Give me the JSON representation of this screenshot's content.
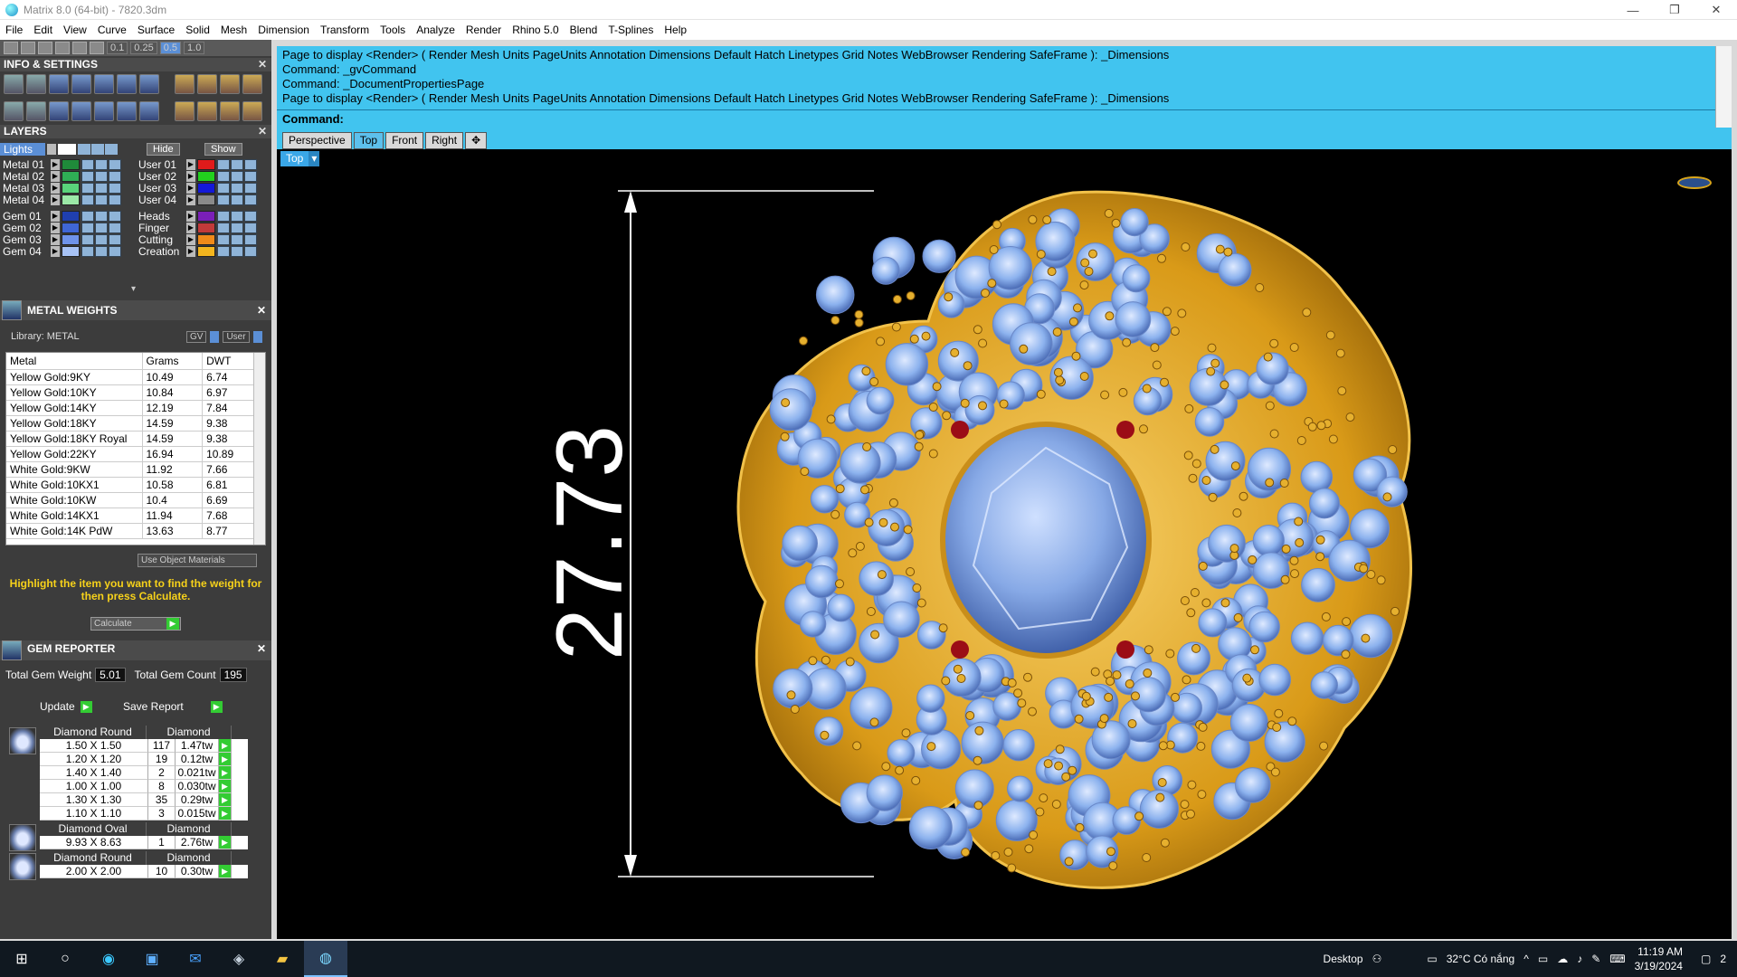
{
  "window": {
    "title": "Matrix 8.0 (64-bit) - 7820.3dm"
  },
  "menu": [
    "File",
    "Edit",
    "View",
    "Curve",
    "Surface",
    "Solid",
    "Mesh",
    "Dimension",
    "Transform",
    "Tools",
    "Analyze",
    "Render",
    "Rhino 5.0",
    "Blend",
    "T-Splines",
    "Help"
  ],
  "toolstrip": {
    "values": [
      "0.1",
      "0.25",
      "0.5",
      "1.0"
    ]
  },
  "info_settings": {
    "title": "INFO & SETTINGS"
  },
  "layers": {
    "title": "LAYERS",
    "lights_label": "Lights",
    "hide_label": "Hide",
    "show_label": "Show",
    "left": [
      {
        "name": "Metal 01",
        "color": "#1f8a3a"
      },
      {
        "name": "Metal 02",
        "color": "#2fae55"
      },
      {
        "name": "Metal 03",
        "color": "#59d37a"
      },
      {
        "name": "Metal 04",
        "color": "#9be8a7"
      },
      {
        "name": "Gem 01",
        "color": "#1f3fb0"
      },
      {
        "name": "Gem 02",
        "color": "#3f66d6"
      },
      {
        "name": "Gem 03",
        "color": "#6f93ea"
      },
      {
        "name": "Gem 04",
        "color": "#a7c2f5"
      }
    ],
    "right": [
      {
        "name": "User 01",
        "color": "#e01b1b"
      },
      {
        "name": "User 02",
        "color": "#22d11e"
      },
      {
        "name": "User 03",
        "color": "#1419d8"
      },
      {
        "name": "User 04",
        "color": "#8a8a8a"
      },
      {
        "name": "Heads",
        "color": "#7a1fb8"
      },
      {
        "name": "Finger",
        "color": "#c23a3a"
      },
      {
        "name": "Cutting",
        "color": "#f08a19"
      },
      {
        "name": "Creation",
        "color": "#f3b51e"
      }
    ]
  },
  "metal_weights": {
    "title": "METAL WEIGHTS",
    "library_label": "Library: METAL",
    "gv_label": "GV",
    "user_label": "User",
    "columns": [
      "Metal",
      "Grams",
      "DWT"
    ],
    "rows": [
      [
        "Yellow Gold:9KY",
        "10.49",
        "6.74"
      ],
      [
        "Yellow Gold:10KY",
        "10.84",
        "6.97"
      ],
      [
        "Yellow Gold:14KY",
        "12.19",
        "7.84"
      ],
      [
        "Yellow Gold:18KY",
        "14.59",
        "9.38"
      ],
      [
        "Yellow Gold:18KY Royal",
        "14.59",
        "9.38"
      ],
      [
        "Yellow Gold:22KY",
        "16.94",
        "10.89"
      ],
      [
        "White Gold:9KW",
        "11.92",
        "7.66"
      ],
      [
        "White Gold:10KX1",
        "10.58",
        "6.81"
      ],
      [
        "White Gold:10KW",
        "10.4",
        "6.69"
      ],
      [
        "White Gold:14KX1",
        "11.94",
        "7.68"
      ],
      [
        "White Gold:14K PdW",
        "13.63",
        "8.77"
      ]
    ],
    "use_object_materials": "Use Object Materials",
    "hint": "Highlight the item you want to find the weight for then press Calculate.",
    "calculate_label": "Calculate"
  },
  "gem_reporter": {
    "title": "GEM REPORTER",
    "total_weight_label": "Total Gem Weight",
    "total_weight": "5.01",
    "total_count_label": "Total Gem Count",
    "total_count": "195",
    "update_label": "Update",
    "save_label": "Save Report",
    "groups": [
      {
        "cut": "Diamond Round",
        "material": "Diamond",
        "rows": [
          [
            "1.50 X 1.50",
            "117",
            "1.47tw"
          ],
          [
            "1.20 X 1.20",
            "19",
            "0.12tw"
          ],
          [
            "1.40 X 1.40",
            "2",
            "0.021tw"
          ],
          [
            "1.00 X 1.00",
            "8",
            "0.030tw"
          ],
          [
            "1.30 X 1.30",
            "35",
            "0.29tw"
          ],
          [
            "1.10 X 1.10",
            "3",
            "0.015tw"
          ]
        ]
      },
      {
        "cut": "Diamond Oval",
        "material": "Diamond",
        "rows": [
          [
            "9.93 X 8.63",
            "1",
            "2.76tw"
          ]
        ]
      },
      {
        "cut": "Diamond Round",
        "material": "Diamond",
        "rows": [
          [
            "2.00 X 2.00",
            "10",
            "0.30tw"
          ]
        ]
      }
    ]
  },
  "command": {
    "history": [
      "Page to display <Render> ( Render  Mesh  Units  PageUnits  Annotation  Dimensions  Default  Hatch  Linetypes  Grid  Notes  WebBrowser  Rendering  SafeFrame ): _Dimensions",
      "Command: _gvCommand",
      "Command: _DocumentPropertiesPage",
      "Page to display <Render> ( Render  Mesh  Units  PageUnits  Annotation  Dimensions  Default  Hatch  Linetypes  Grid  Notes  WebBrowser  Rendering  SafeFrame ): _Dimensions"
    ],
    "prompt": "Command:"
  },
  "viewport_tabs": [
    "Perspective",
    "Top",
    "Front",
    "Right"
  ],
  "viewport": {
    "label": "Top",
    "dimension": "27.73"
  },
  "taskbar": {
    "desktop_label": "Desktop",
    "weather": "32°C  Có nắng",
    "time": "11:19 AM",
    "date": "3/19/2024",
    "notifications": "2"
  }
}
